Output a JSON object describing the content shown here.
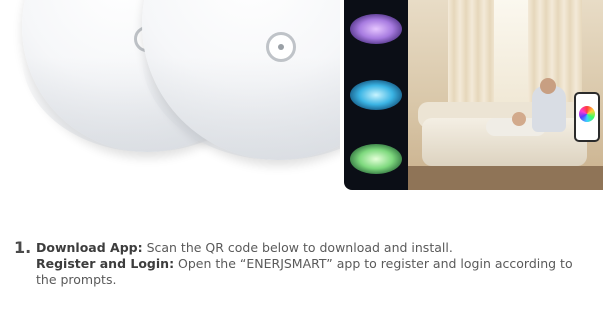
{
  "hero": {
    "fixtures_image": "ceiling-light-fixtures",
    "color_variants": [
      "#a77be0",
      "#3bb4e4",
      "#7ed97e"
    ],
    "scene_image": "living-room-scene"
  },
  "instructions": {
    "step_number": "1.",
    "download_label": "Download App:",
    "download_text": " Scan the QR code below to download and install.",
    "register_label": "Register and Login:",
    "register_text": " Open the “ENERJSMART” app to register and login according to the prompts."
  }
}
